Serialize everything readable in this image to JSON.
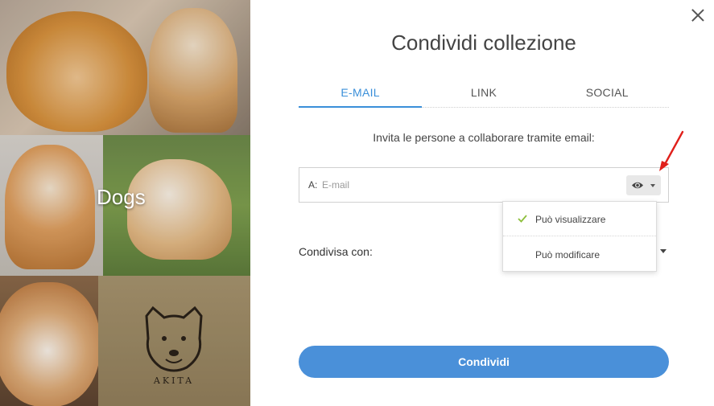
{
  "collection": {
    "name": "Dogs"
  },
  "dialog": {
    "title": "Condividi collezione",
    "tabs": [
      {
        "label": "E-MAIL",
        "active": true
      },
      {
        "label": "LINK",
        "active": false
      },
      {
        "label": "SOCIAL",
        "active": false
      }
    ],
    "invite_text": "Invita le persone a collaborare tramite email:",
    "email": {
      "to_label": "A:",
      "placeholder": "E-mail",
      "value": ""
    },
    "permission_toggle": {
      "icon": "eye-icon"
    },
    "permission_menu": {
      "items": [
        {
          "label": "Può visualizzare",
          "selected": true
        },
        {
          "label": "Può modificare",
          "selected": false
        }
      ]
    },
    "shared_with_label": "Condivisa con:",
    "share_button": "Condividi",
    "close_icon": "close-icon"
  },
  "colors": {
    "accent": "#4a90d9",
    "tab_active": "#3a8fd9",
    "check": "#8dbf3c",
    "annotation_arrow": "#e0201b"
  },
  "collage_tiles": [
    {
      "image": "cat-and-akita"
    },
    {
      "image": "shiba-inu"
    },
    {
      "image": "akita-puppy-on-grass"
    },
    {
      "image": "akita-face"
    },
    {
      "image": "akita-logo",
      "logo_text": "AKITA"
    }
  ]
}
